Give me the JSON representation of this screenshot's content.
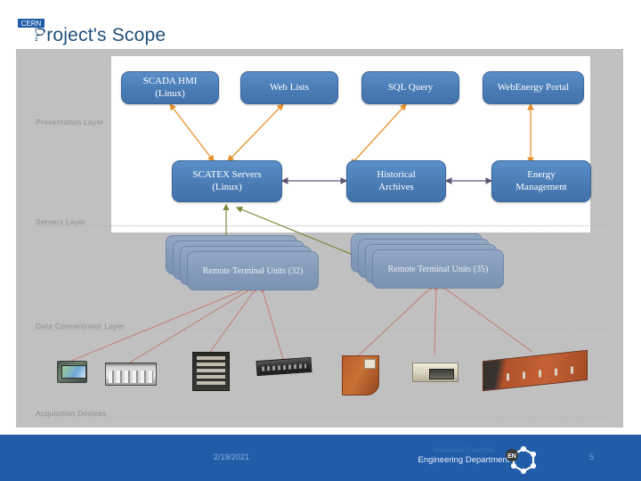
{
  "slide": {
    "title": "Project's Scope"
  },
  "diagram": {
    "layers": [
      {
        "id": "presentation",
        "label": "Presentation Layer"
      },
      {
        "id": "servers",
        "label": "Servers Layer"
      },
      {
        "id": "concentrator",
        "label": "Data Concentrator Layer"
      },
      {
        "id": "acquisition",
        "label": "Acquisition Devices"
      }
    ],
    "presentation_nodes": [
      {
        "id": "scada-hmi",
        "line1": "SCADA HMI",
        "line2": "(Linux)"
      },
      {
        "id": "web-lists",
        "line1": "Web Lists",
        "line2": ""
      },
      {
        "id": "sql-query",
        "line1": "SQL Query",
        "line2": ""
      },
      {
        "id": "webenergy-portal",
        "line1": "WebEnergy Portal",
        "line2": ""
      }
    ],
    "server_nodes": [
      {
        "id": "scatex-servers",
        "line1": "SCATEX Servers",
        "line2": "(Linux)"
      },
      {
        "id": "historical-archives",
        "line1": "Historical",
        "line2": "Archives"
      },
      {
        "id": "energy-management",
        "line1": "Energy",
        "line2": "Management"
      }
    ],
    "rtu_stacks": [
      {
        "id": "rtu-left",
        "line1": "Remote Terminal Units",
        "line2": "(32)",
        "count": "32"
      },
      {
        "id": "rtu-right",
        "line1": "Remote Terminal Units",
        "line2": "(35)",
        "count": "35"
      }
    ],
    "acquisition_devices": [
      {
        "id": "hmi-panel",
        "icon": "hmi-panel-device"
      },
      {
        "id": "plc-module",
        "icon": "plc-module-device"
      },
      {
        "id": "equipment-rack",
        "icon": "equipment-rack-device"
      },
      {
        "id": "rack-server",
        "icon": "rack-server-device"
      },
      {
        "id": "control-cabinet",
        "icon": "control-cabinet-device"
      },
      {
        "id": "bench-instrument",
        "icon": "bench-instrument-device"
      },
      {
        "id": "cabinet-row",
        "icon": "cabinet-row-device"
      }
    ],
    "colors": {
      "panel_background": "#c0c0c0",
      "inner_panel": "#ffffff",
      "node_blue": "#4a7cb5",
      "rtu_blue": "#8299b8",
      "arrow_orange": "#e8922e",
      "arrow_purple": "#5f5577",
      "arrow_green": "#7b8a3c",
      "arrow_red": "#c4776b",
      "title_blue": "#1f4e79",
      "footer_blue": "#205ca8"
    }
  },
  "footer": {
    "date": "2/19/2021",
    "dept_line1": "Industrial Controls",
    "dept_line2": "Engineering Department",
    "badge": "EN",
    "page_number": "5",
    "logo": "CERN"
  }
}
